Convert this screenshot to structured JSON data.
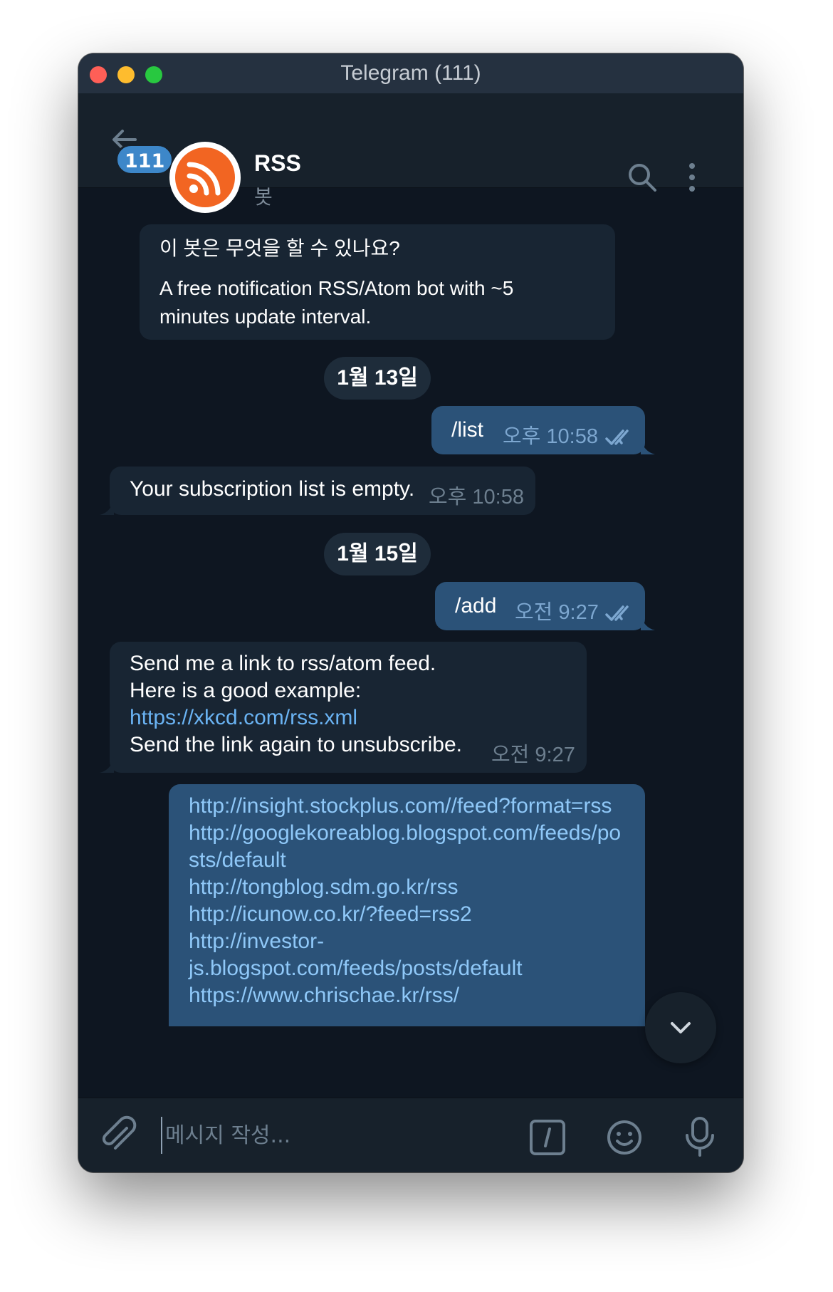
{
  "window": {
    "title": "Telegram (111)"
  },
  "header": {
    "unread_count": "111",
    "chat_name": "RSS",
    "chat_status": "봇"
  },
  "messages": {
    "intro": {
      "question": "이 봇은 무엇을 할 수 있나요?",
      "answer_line1": "A free notification RSS/Atom bot with ~5",
      "answer_line2": "minutes update interval."
    },
    "date1": "1월 13일",
    "out_list": {
      "text": "/list",
      "time": "오후 10:58"
    },
    "in_empty": {
      "text": "Your subscription list is empty.",
      "time": "오후 10:58"
    },
    "date2": "1월 15일",
    "out_add": {
      "text": "/add",
      "time": "오전 9:27"
    },
    "in_send": {
      "line1": "Send me a link to rss/atom feed.",
      "line2": "Here is a good example:",
      "link": "https://xkcd.com/rss.xml",
      "line4": "Send the link again to unsubscribe.",
      "time": "오전 9:27"
    },
    "out_feeds": [
      "http://insight.stockplus.com//feed?format=rss",
      "http://googlekoreablog.blogspot.com/feeds/po",
      "sts/default",
      "http://tongblog.sdm.go.kr/rss",
      "http://icunow.co.kr/?feed=rss2",
      "http://investor-",
      "js.blogspot.com/feeds/posts/default",
      "https://www.chrischae.kr/rss/"
    ]
  },
  "composer": {
    "placeholder": "메시지 작성..."
  },
  "icons": {
    "back": "arrow-left-icon",
    "avatar": "rss-icon",
    "search": "search-icon",
    "menu": "more-vertical-icon",
    "read": "double-check-icon",
    "scroll": "chevron-down-icon",
    "attach": "paperclip-icon",
    "command": "slash-command-icon",
    "emoji": "smiley-icon",
    "mic": "microphone-icon"
  },
  "colors": {
    "background": "#0e1621",
    "header": "#17212b",
    "incoming_bubble": "#182533",
    "outgoing_bubble": "#2b5278",
    "link": "#6ab3f3",
    "badge": "#3d87c9",
    "rss_orange": "#f26522"
  }
}
